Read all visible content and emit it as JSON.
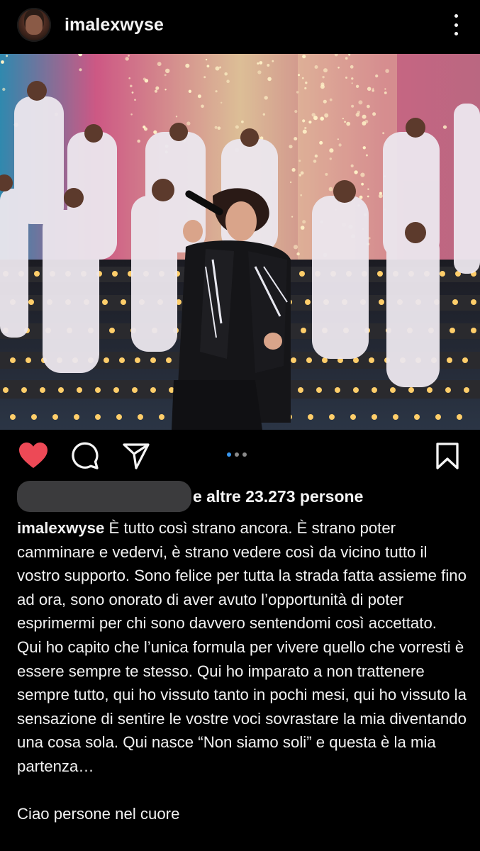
{
  "post": {
    "username": "imalexwyse",
    "avatar_icon": "profile-avatar",
    "more_icon": "vertical-ellipsis-icon"
  },
  "carousel": {
    "count": 3,
    "active_index": 0
  },
  "actions": {
    "like_icon": "heart-filled-icon",
    "like_color": "#ed4956",
    "comment_icon": "comment-bubble-icon",
    "share_icon": "paper-plane-icon",
    "save_icon": "bookmark-icon"
  },
  "likes": {
    "names_redacted": true,
    "text": "e altre 23.273 persone"
  },
  "caption": {
    "username": "imalexwyse",
    "paragraphs": [
      "È tutto così strano ancora. È strano poter camminare e vedervi, è strano vedere così da vicino tutto il vostro supporto. Sono felice per tutta la strada fatta assieme fino ad ora, sono onorato di aver avuto l’opportunità di poter esprimermi per chi sono davvero sentendomi così accettato.",
      "Qui ho capito che l’unica formula per vivere quello che vorresti è essere sempre te stesso. Qui ho imparato a non trattenere sempre tutto, qui ho vissuto tanto in pochi mesi, qui ho vissuto la sensazione di sentire le vostre voci sovrastare la mia diventando una cosa sola. Qui nasce “Non siamo soli” e questa è la mia partenza…",
      "Ciao persone nel cuore"
    ]
  },
  "colors": {
    "background": "#000000",
    "text": "#f5f5f5",
    "accent_dot": "#3897f0",
    "like_red": "#ed4956"
  }
}
